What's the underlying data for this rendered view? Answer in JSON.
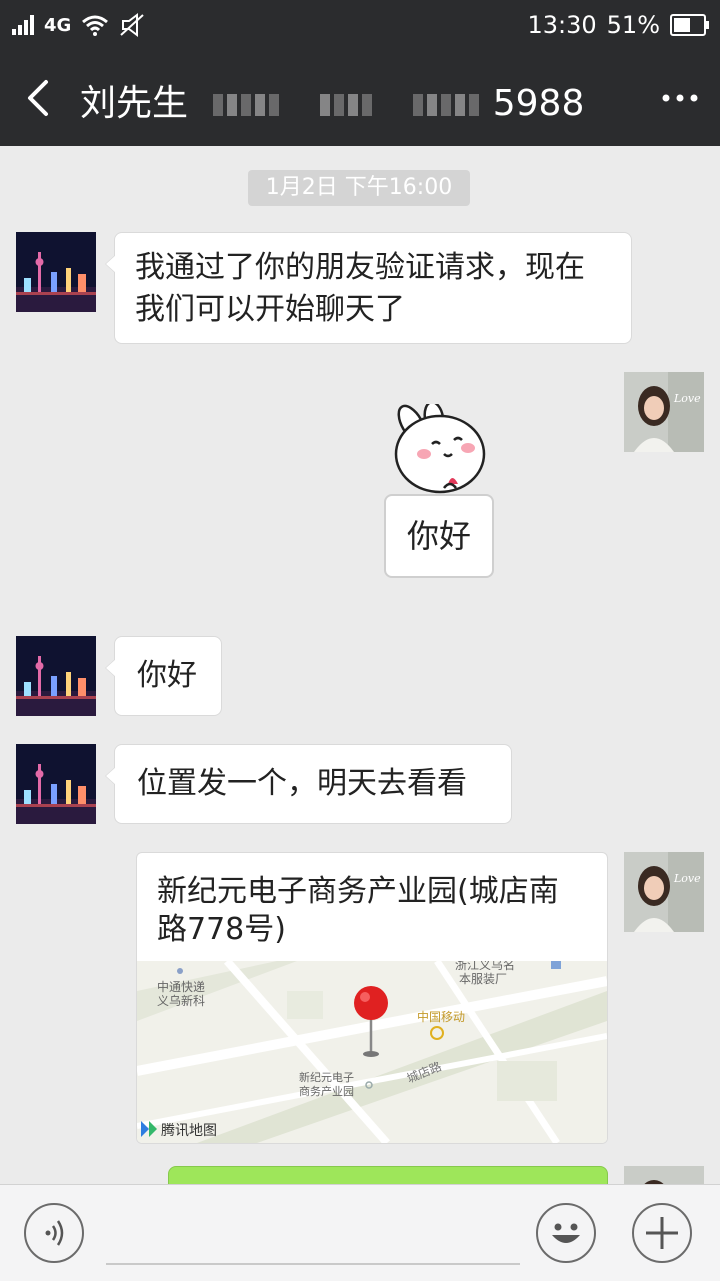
{
  "status_bar": {
    "network": "4G",
    "time": "13:30",
    "battery": "51%",
    "icons": [
      "signal-icon",
      "wifi-icon",
      "mute-icon",
      "battery-icon"
    ]
  },
  "header": {
    "back_icon": "chevron-left-icon",
    "title_name": "刘先生",
    "title_number_visible": "5988",
    "more_icon": "more-dots-icon"
  },
  "chat": {
    "timestamp": "1月2日 下午16:00",
    "messages": [
      {
        "side": "left",
        "type": "text",
        "text": "我通过了你的朋友验证请求，现在我们可以开始聊天了"
      },
      {
        "side": "right",
        "type": "sticker",
        "text": "你好"
      },
      {
        "side": "left",
        "type": "text",
        "text": "你好"
      },
      {
        "side": "left",
        "type": "text",
        "text": "位置发一个，明天去看看"
      },
      {
        "side": "right",
        "type": "location",
        "title": "新纪元电子商务产业园(城店南路778号)"
      },
      {
        "side": "right",
        "type": "text",
        "text": ""
      }
    ],
    "map_labels": {
      "label1": "中通快递",
      "label2": "义乌新科",
      "label3": "浙江义乌名",
      "label4": "本服装厂",
      "label5": "中国移动",
      "label6": "城店路",
      "label7": "新纪元电子",
      "label8": "商务产业园",
      "provider": "腾讯地图"
    }
  },
  "input_bar": {
    "voice_icon": "voice-icon",
    "emoji_icon": "emoji-icon",
    "plus_icon": "plus-icon"
  },
  "colors": {
    "bar_bg": "#2b2c2e",
    "chat_bg": "#ebebeb",
    "bubble_green": "#9ee65a"
  }
}
